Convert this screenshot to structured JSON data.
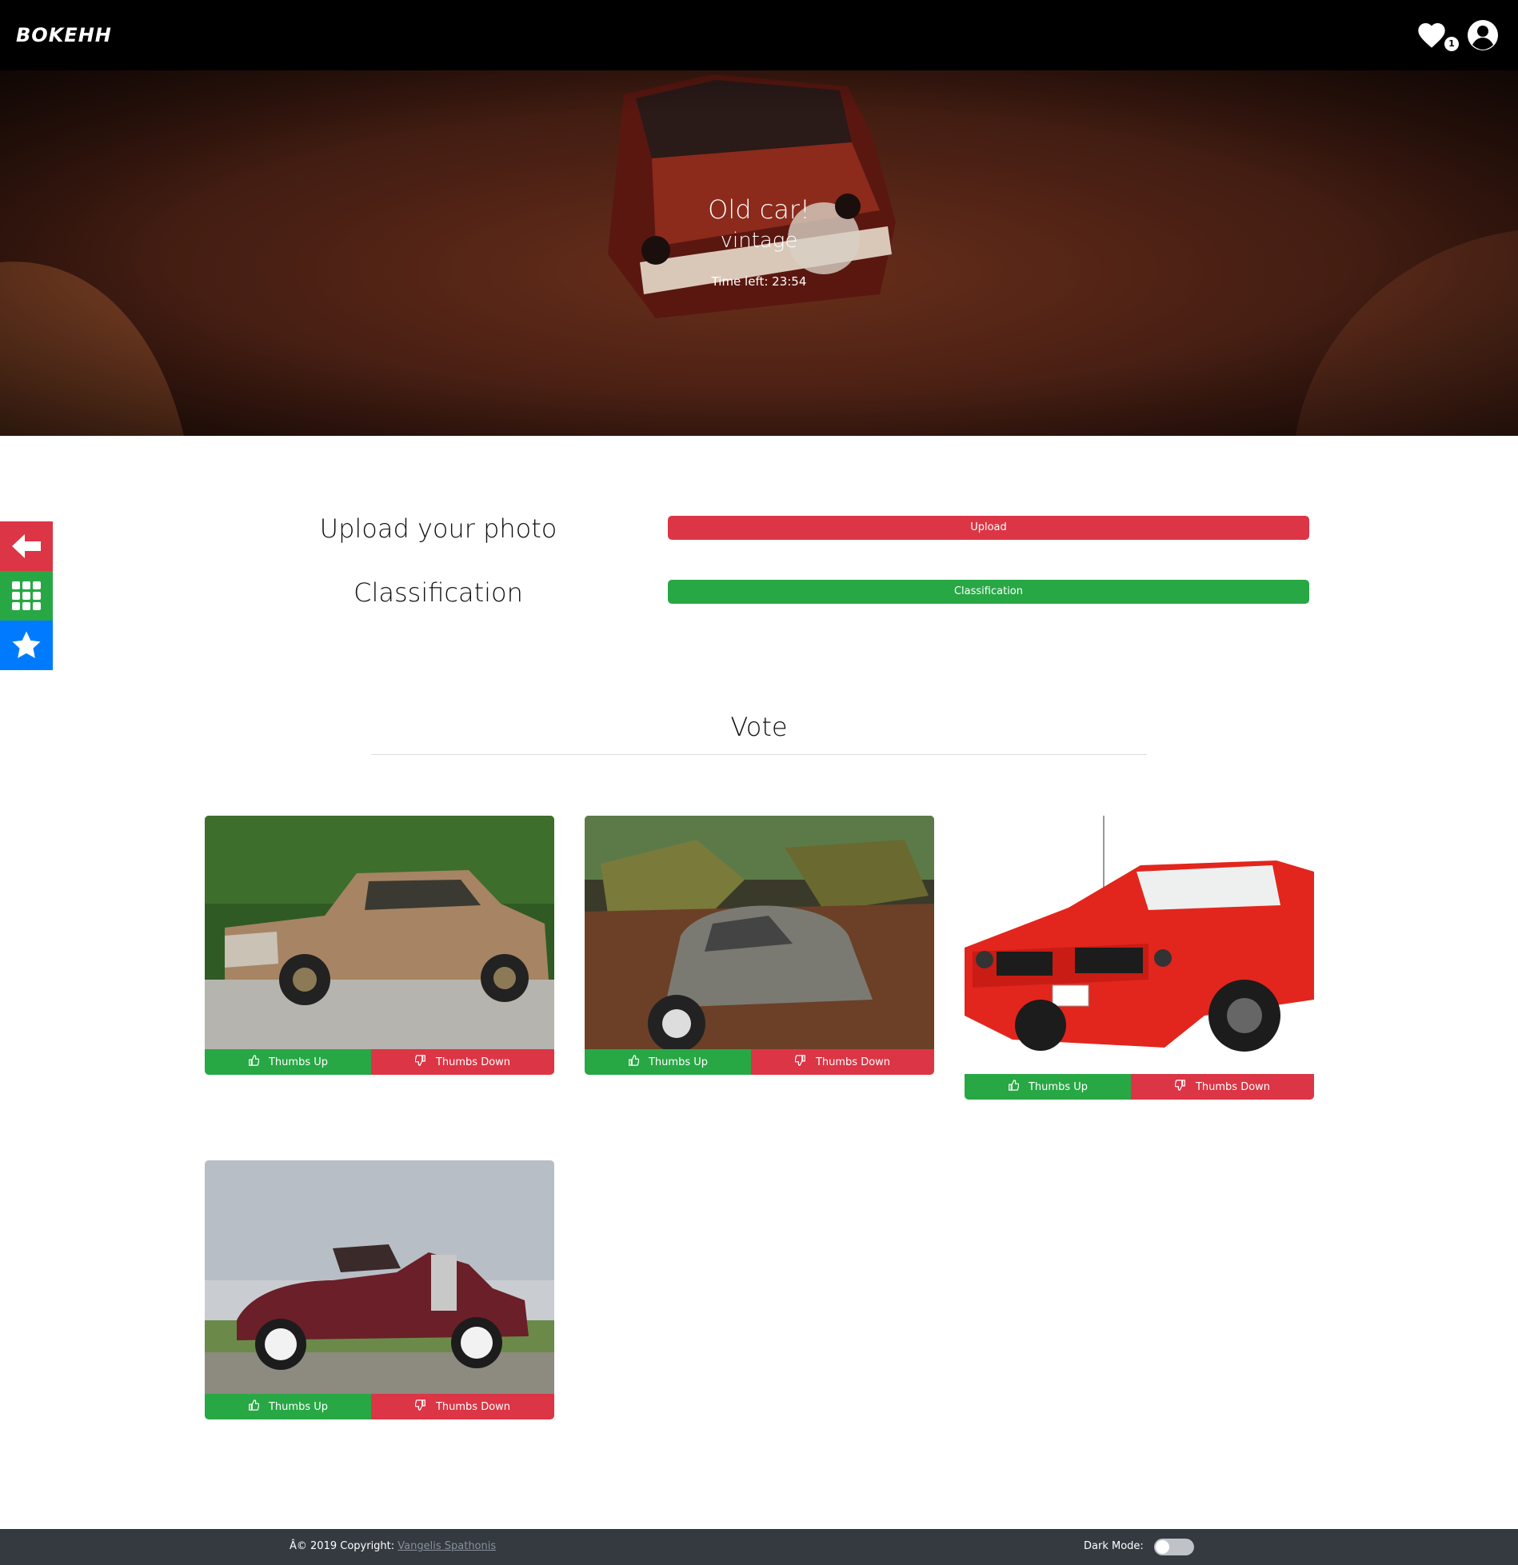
{
  "navbar": {
    "brand": "BOKEHH",
    "favorites_count": "1"
  },
  "hero": {
    "title": "Old car!",
    "subtitle": "vintage",
    "time_left": "Time left: 23:54"
  },
  "actions": {
    "upload_label": "Upload your photo",
    "upload_button": "Upload",
    "classification_label": "Classification",
    "classification_button": "Classification"
  },
  "vote": {
    "title": "Vote",
    "cards": [
      {
        "thumbs_up": "Thumbs Up",
        "thumbs_down": "Thumbs Down"
      },
      {
        "thumbs_up": "Thumbs Up",
        "thumbs_down": "Thumbs Down"
      },
      {
        "thumbs_up": "Thumbs Up",
        "thumbs_down": "Thumbs Down"
      },
      {
        "thumbs_up": "Thumbs Up",
        "thumbs_down": "Thumbs Down"
      }
    ]
  },
  "footer": {
    "copyright": "Â© 2019 Copyright: ",
    "author": "Vangelis Spathonis",
    "dark_mode_label": "Dark Mode:"
  },
  "colors": {
    "navbar": "#000000",
    "red": "#dc3545",
    "green": "#28a745",
    "blue": "#007bff",
    "footer": "#343a40"
  }
}
